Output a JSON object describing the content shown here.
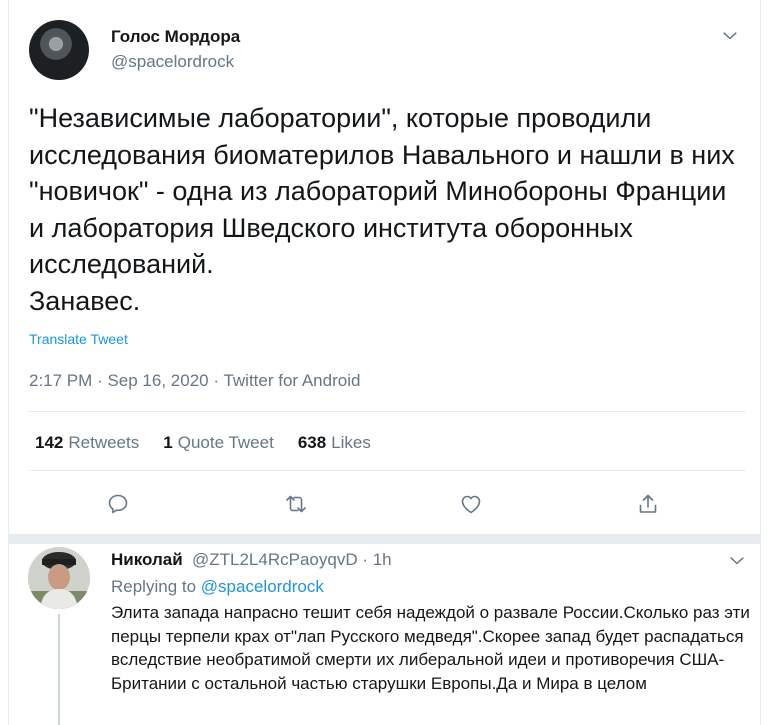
{
  "tweet": {
    "author_name": "Голос Мордора",
    "author_handle": "@spacelordrock",
    "text": "\"Независимые лаборатории\", которые проводили исследования биоматерилов Навального и нашли в них \"новичок\" - одна из лабораторий Минобороны Франции и лаборатория Шведского института оборонных исследований.\nЗанавес.",
    "translate_label": "Translate Tweet",
    "time": "2:17 PM",
    "date": "Sep 16, 2020",
    "source": "Twitter for Android",
    "meta_separator": "·",
    "retweets_count": "142",
    "retweets_label": "Retweets",
    "quotes_count": "1",
    "quotes_label": "Quote Tweet",
    "likes_count": "638",
    "likes_label": "Likes"
  },
  "reply": {
    "author_name": "Николай",
    "author_handle": "@ZTL2L4RcPaoyqvD · 1h",
    "replying_prefix": "Replying to",
    "replying_to": "@spacelordrock",
    "text": "Элита запада напрасно тешит себя надеждой о развале России.Сколько раз эти перцы терпели крах от\"лап Русского медведя\".Скорее запад будет распадаться вследствие необратимой смерти их либеральной идеи и противоречия США-Британии с остальной частью старушки Европы.Да и Мира в целом"
  },
  "icons": {
    "reply": "reply-icon",
    "retweet": "retweet-icon",
    "like": "heart-icon",
    "share": "share-icon",
    "more": "chevron-down-icon"
  },
  "colors": {
    "link": "#1b95e0",
    "muted": "#657786",
    "text": "#14171a",
    "border": "#e6ecf0"
  }
}
